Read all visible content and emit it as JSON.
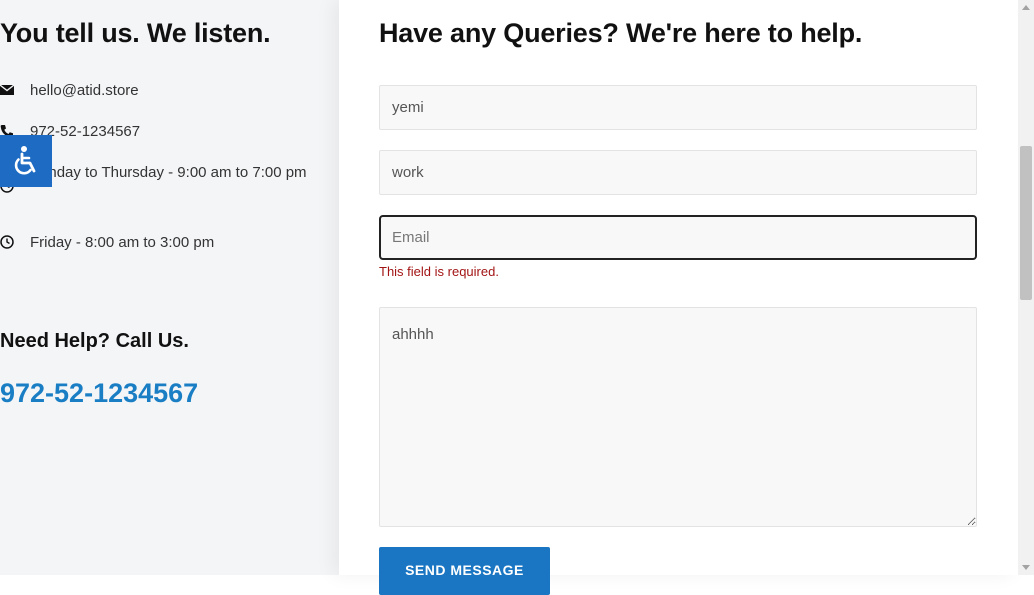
{
  "left": {
    "heading": "You tell us. We listen.",
    "contacts": [
      {
        "icon": "envelope-icon",
        "text": "hello@atid.store"
      },
      {
        "icon": "phone-icon",
        "text": "972-52-1234567"
      },
      {
        "icon": "clock-icon",
        "text": "Sunday to Thursday - 9:00 am to 7:00 pm"
      },
      {
        "icon": "clock-icon",
        "text": "Friday - 8:00 am to 3:00 pm"
      }
    ],
    "help_title": "Need Help? Call Us.",
    "help_phone": "972-52-1234567"
  },
  "accessibility": {
    "icon": "accessibility-icon",
    "color": "#1d6bc3"
  },
  "form": {
    "heading": "Have any Queries? We're here to help.",
    "name_value": "yemi",
    "subject_value": "work",
    "email_value": "",
    "email_placeholder": "Email",
    "email_error": "This field is required.",
    "message_value": "ahhhh",
    "submit_label": "SEND MESSAGE"
  },
  "colors": {
    "accent": "#1a76c2",
    "error": "#a31515",
    "phone_link": "#1a7ec4"
  }
}
